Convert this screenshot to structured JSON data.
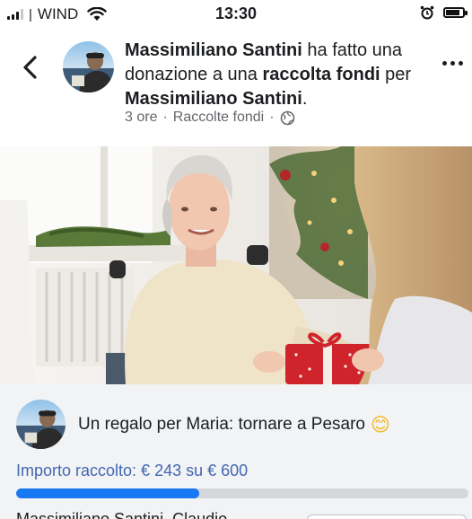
{
  "status_bar": {
    "carrier": "WIND",
    "time": "13:30",
    "battery_level": 0.85
  },
  "post": {
    "author": "Massimiliano Santini",
    "action_text_1": " ha fatto una donazione a una ",
    "link_text": "raccolta fondi",
    "action_text_2": " per ",
    "beneficiary": "Massimiliano Santini",
    "end_punct": ".",
    "time_ago": "3 ore",
    "separator": "·",
    "category": "Raccolte fondi",
    "separator2": "·",
    "audience_icon": "globe-icon"
  },
  "fundraiser": {
    "title": "Un regalo per Maria: tornare a Pesaro",
    "emoji": "😊",
    "raised_text": "Importo raccolto: € 243 su € 600",
    "raised_amount": 243,
    "goal_amount": 600,
    "progress_fraction": 0.405,
    "donors_preview": "Massimiliano Santini, Claudio"
  },
  "colors": {
    "link_blue": "#4267b2",
    "progress_blue": "#1877f2",
    "card_bg": "#f2f3f5",
    "meta_gray": "#65676b"
  },
  "icons": [
    "back-arrow-icon",
    "more-options-icon",
    "globe-icon",
    "wifi-icon",
    "alarm-icon",
    "battery-icon",
    "signal-icon"
  ]
}
